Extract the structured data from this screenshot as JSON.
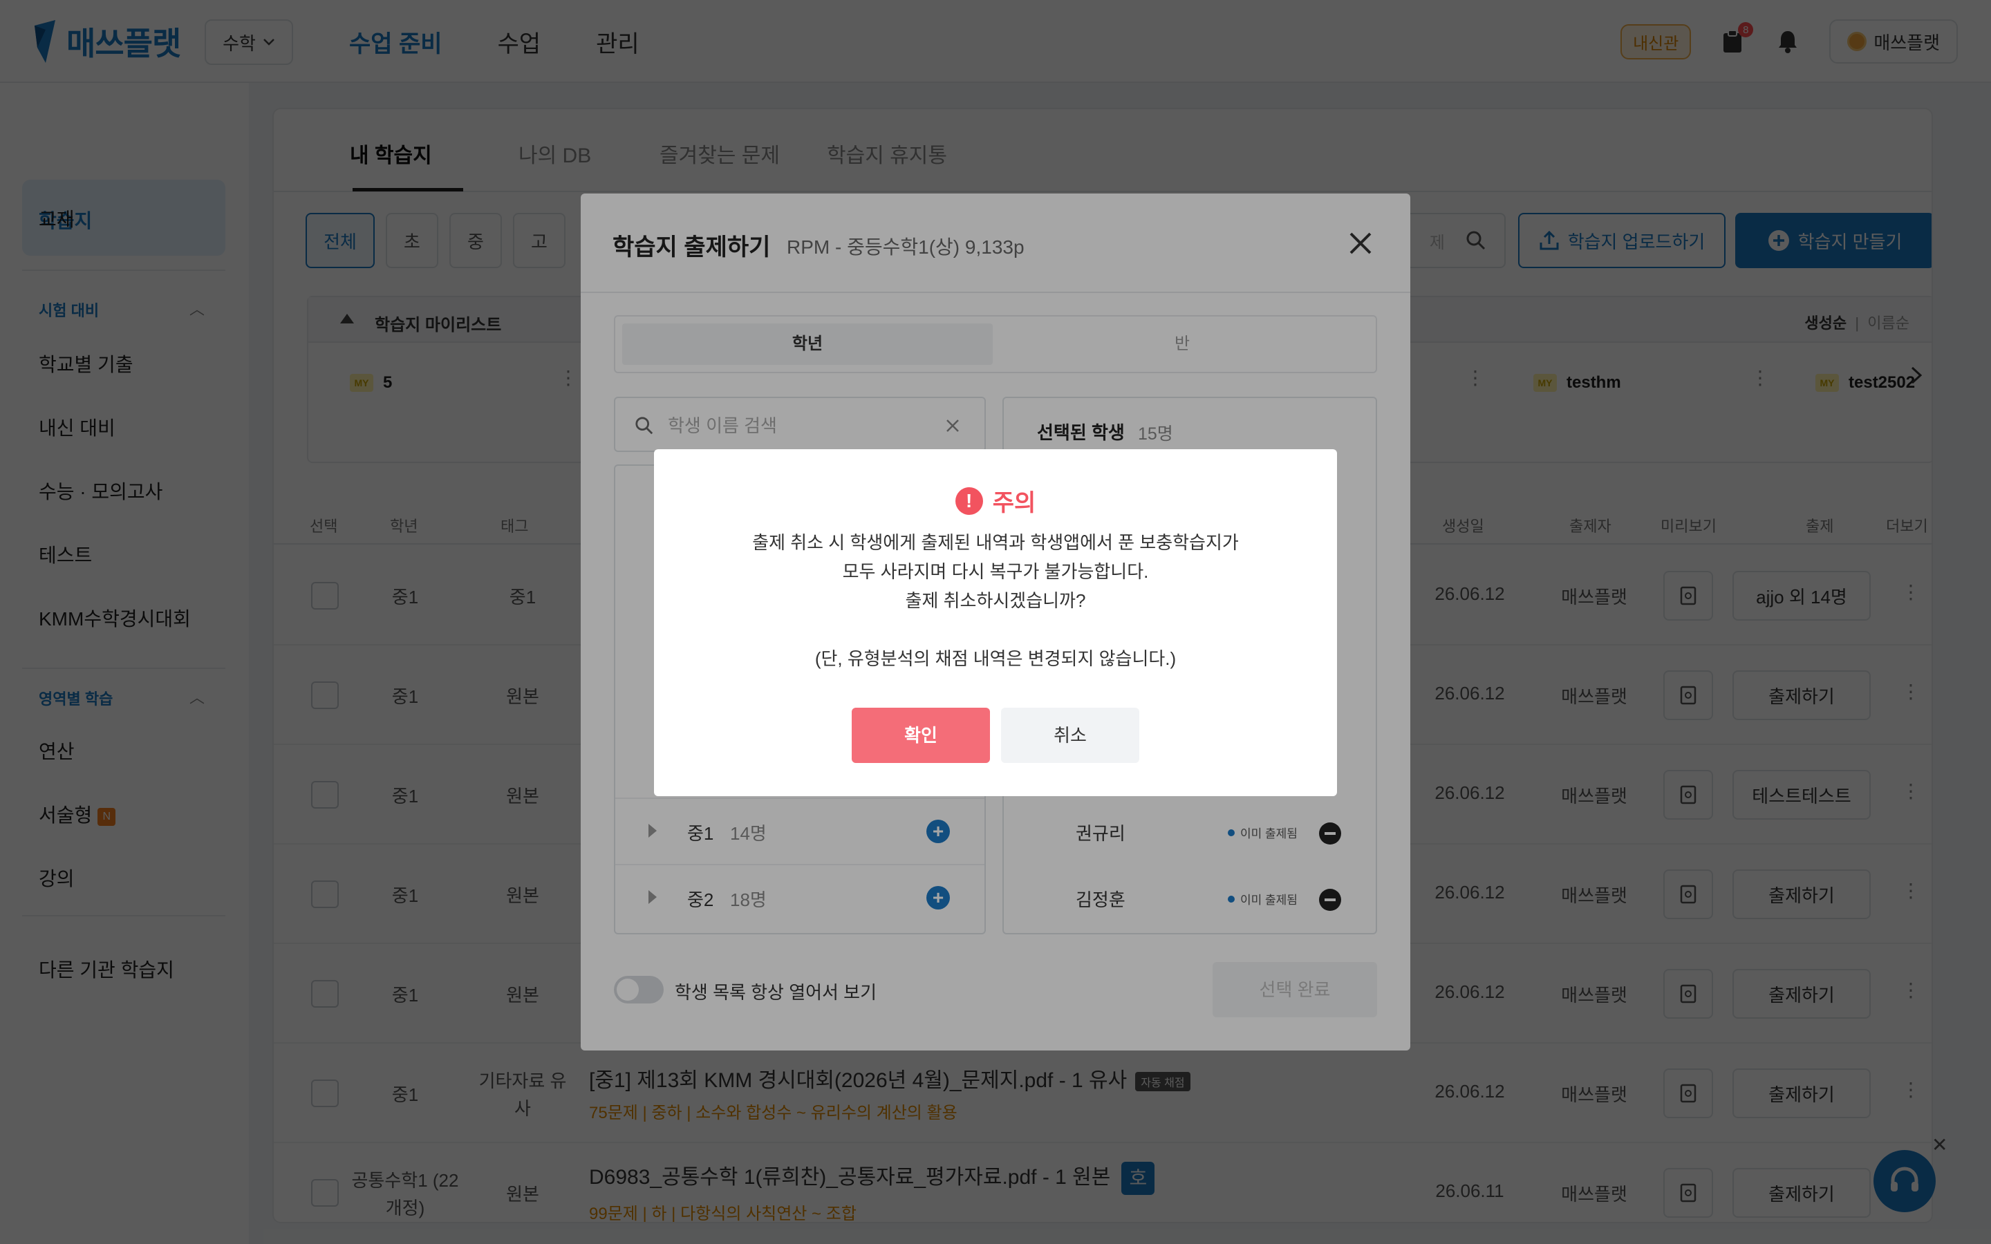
{
  "app": {
    "logo": "매쓰플랫",
    "subject": "수학"
  },
  "nav": {
    "items": [
      "수업 준비",
      "수업",
      "관리"
    ]
  },
  "topbar": {
    "naesin": "내신관",
    "notif_count": "8",
    "user": "매쓰플랫"
  },
  "sidebar": {
    "main": "학습지",
    "textbook": "교재",
    "exam_section": "시험 대비",
    "exam_items": [
      "학교별 기출",
      "내신 대비",
      "수능 · 모의고사",
      "테스트",
      "KMM수학경시대회"
    ],
    "area_section": "영역별 학습",
    "area_items": [
      "연산",
      "서술형",
      "강의"
    ],
    "new_badge": "N",
    "other": "다른 기관 학습지"
  },
  "tabs": [
    "내 학습지",
    "나의 DB",
    "즐겨찾는 문제",
    "학습지 휴지통"
  ],
  "filters": [
    "전체",
    "초",
    "중",
    "고"
  ],
  "toolbar": {
    "search_stub": "제",
    "upload": "학습지 업로드하기",
    "make": "학습지 만들기"
  },
  "mylist": {
    "title": "학습지 마이리스트",
    "sort_a": "생성순",
    "sort_b": "이름순",
    "tag": "MY",
    "items": [
      "5",
      "testhm",
      "test2502"
    ]
  },
  "table": {
    "headers": [
      "선택",
      "학년",
      "태그",
      "생성일",
      "출제자",
      "미리보기",
      "출제",
      "더보기"
    ],
    "rows": [
      {
        "grade": "중1",
        "tag": "중1",
        "date": "26.06.12",
        "author": "매쓰플랫",
        "assign": "ajjo 외 14명"
      },
      {
        "grade": "중1",
        "tag": "원본",
        "date": "26.06.12",
        "author": "매쓰플랫",
        "assign": "출제하기"
      },
      {
        "grade": "중1",
        "tag": "원본",
        "date": "26.06.12",
        "author": "매쓰플랫",
        "assign": "테스트테스트"
      },
      {
        "grade": "중1",
        "tag": "원본",
        "date": "26.06.12",
        "author": "매쓰플랫",
        "assign": "출제하기"
      },
      {
        "grade": "중1",
        "tag": "원본",
        "date": "26.06.12",
        "author": "매쓰플랫",
        "assign": "출제하기"
      },
      {
        "grade": "중1",
        "tag": "기타자료 유사",
        "date": "26.06.12",
        "author": "매쓰플랫",
        "assign": "출제하기",
        "title": "[중1] 제13회 KMM 경시대회(2026년 4월)_문제지.pdf - 1 유사",
        "badge": "자동 채점",
        "sub": "75문제 | 중하 | 소수와 합성수 ~ 유리수의 계산의 활용"
      },
      {
        "grade": "공통수학1 (22개정)",
        "tag": "원본",
        "date": "26.06.11",
        "author": "매쓰플랫",
        "assign": "출제하기",
        "title": "D6983_공통수학 1(류희찬)_공통자료_평가자료.pdf - 1 원본",
        "badge": "호",
        "sub": "99문제 | 하 | 다항식의 사칙연산 ~ 조합"
      }
    ]
  },
  "assign_modal": {
    "title": "학습지 출제하기",
    "subtitle": "RPM - 중등수학1(상) 9,133p",
    "seg_a": "학년",
    "seg_b": "반",
    "search_placeholder": "학생 이름 검색",
    "selected_label": "선택된 학생",
    "selected_count": "15명",
    "grades": [
      {
        "name": "중1",
        "count": "14명"
      },
      {
        "name": "중2",
        "count": "18명"
      }
    ],
    "students": [
      {
        "name": "권규리",
        "status": "이미 출제됨"
      },
      {
        "name": "김정훈",
        "status": "이미 출제됨"
      }
    ],
    "toggle_label": "학생 목록 항상 열어서 보기",
    "done": "선택 완료"
  },
  "alert": {
    "title": "주의",
    "lines": [
      "출제 취소 시 학생에게 출제된 내역과 학생앱에서 푼 보충학습지가",
      "모두 사라지며 다시 복구가 불가능합니다.",
      "출제 취소하시겠습니까?",
      "",
      "(단, 유형분석의 채점 내역은 변경되지 않습니다.)"
    ],
    "confirm": "확인",
    "cancel": "취소"
  }
}
